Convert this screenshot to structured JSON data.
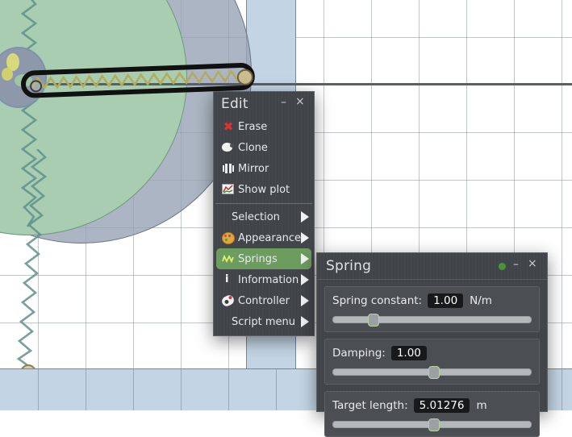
{
  "scene": {
    "name": "physics-sandbox-canvas",
    "colors": {
      "water": "#c3d5e4",
      "green_disk": "#a9cdb0",
      "grey_disk": "#96a3b4",
      "spring_wire": "#b5ab5d",
      "selection_outline": "#111111",
      "ground_line": "#5a5f63"
    }
  },
  "edit_menu": {
    "title": "Edit",
    "minimize_label": "–",
    "close_label": "×",
    "items": [
      {
        "label": "Erase",
        "icon": "erase-icon",
        "submenu": false,
        "selected": false
      },
      {
        "label": "Clone",
        "icon": "clone-icon",
        "submenu": false,
        "selected": false
      },
      {
        "label": "Mirror",
        "icon": "mirror-icon",
        "submenu": false,
        "selected": false
      },
      {
        "label": "Show plot",
        "icon": "plot-icon",
        "submenu": false,
        "selected": false
      },
      {
        "label": "Selection",
        "icon": "none",
        "submenu": true,
        "selected": false
      },
      {
        "label": "Appearance",
        "icon": "palette-icon",
        "submenu": true,
        "selected": false
      },
      {
        "label": "Springs",
        "icon": "spring-icon",
        "submenu": true,
        "selected": true
      },
      {
        "label": "Information",
        "icon": "info-icon",
        "submenu": true,
        "selected": false
      },
      {
        "label": "Controller",
        "icon": "controller-icon",
        "submenu": true,
        "selected": false
      },
      {
        "label": "Script menu",
        "icon": "none",
        "submenu": true,
        "selected": false
      }
    ],
    "highlight_color": "#6d9c5f"
  },
  "spring_panel": {
    "title": "Spring",
    "pin_label": "",
    "minimize_label": "–",
    "close_label": "×",
    "fields": [
      {
        "label": "Spring constant:",
        "value": "1.00",
        "unit": "N/m",
        "knob_pct": 18
      },
      {
        "label": "Damping:",
        "value": "1.00",
        "unit": "",
        "knob_pct": 48
      },
      {
        "label": "Target length:",
        "value": "5.01276",
        "unit": "m",
        "knob_pct": 48
      }
    ]
  }
}
